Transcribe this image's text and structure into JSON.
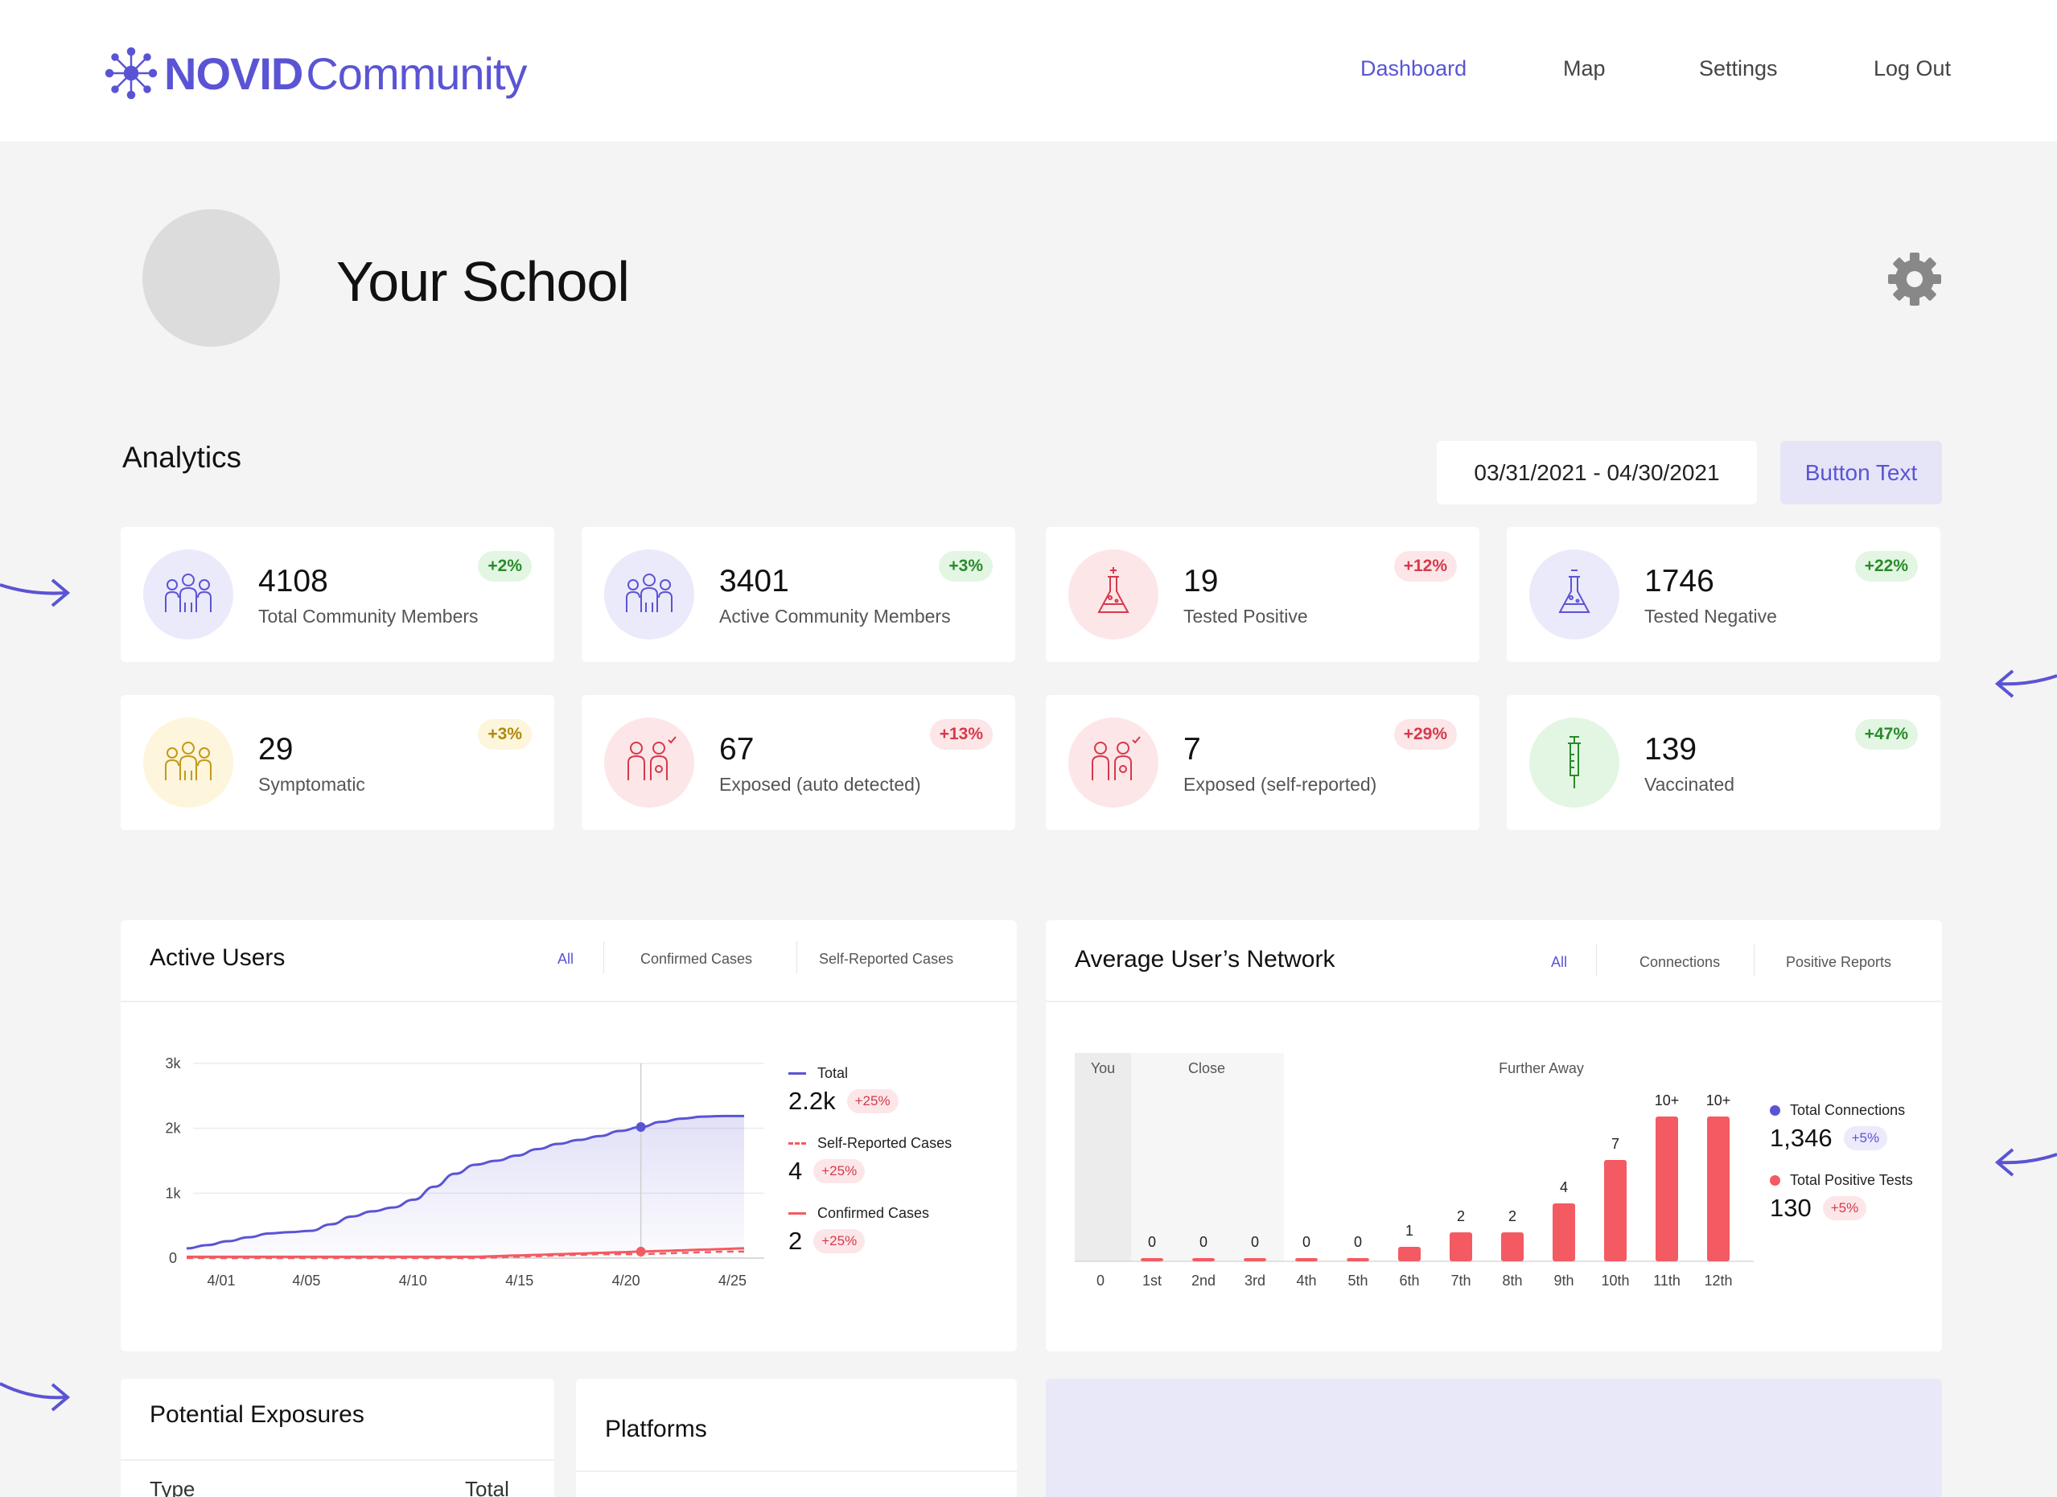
{
  "brand": {
    "bold": "NOVID",
    "light": "Community"
  },
  "nav": [
    {
      "label": "Dashboard",
      "active": true
    },
    {
      "label": "Map",
      "active": false
    },
    {
      "label": "Settings",
      "active": false
    },
    {
      "label": "Log Out",
      "active": false
    }
  ],
  "school": {
    "name": "Your School"
  },
  "analytics": {
    "title": "Analytics",
    "date_range": "03/31/2021 - 04/30/2021",
    "button_label": "Button Text"
  },
  "stats": [
    {
      "value": "4108",
      "label": "Total Community Members",
      "change": "+2%",
      "tone": "green",
      "icon": "people-icon"
    },
    {
      "value": "3401",
      "label": "Active Community Members",
      "change": "+3%",
      "tone": "green",
      "icon": "people-icon"
    },
    {
      "value": "19",
      "label": "Tested Positive",
      "change": "+12%",
      "tone": "red",
      "icon": "flask-positive-icon"
    },
    {
      "value": "1746",
      "label": "Tested Negative",
      "change": "+22%",
      "tone": "green",
      "icon": "flask-negative-icon"
    },
    {
      "value": "29",
      "label": "Symptomatic",
      "change": "+3%",
      "tone": "yellow",
      "icon": "symptomatic-people-icon"
    },
    {
      "value": "67",
      "label": "Exposed (auto detected)",
      "change": "+13%",
      "tone": "red",
      "icon": "exposed-people-icon"
    },
    {
      "value": "7",
      "label": "Exposed (self-reported)",
      "change": "+29%",
      "tone": "red",
      "icon": "exposed-people-icon"
    },
    {
      "value": "139",
      "label": "Vaccinated",
      "change": "+47%",
      "tone": "green",
      "icon": "syringe-icon"
    }
  ],
  "colors": {
    "accent": "#5a54d4",
    "positive_red": "#f45a62",
    "green": "#2a8a2a"
  },
  "active_users": {
    "title": "Active Users",
    "tabs": [
      {
        "label": "All",
        "active": true
      },
      {
        "label": "Confirmed Cases",
        "active": false
      },
      {
        "label": "Self-Reported Cases",
        "active": false
      }
    ],
    "legend": [
      {
        "name": "Total",
        "value": "2.2k",
        "change": "+25%"
      },
      {
        "name": "Self-Reported Cases",
        "value": "4",
        "change": "+25%"
      },
      {
        "name": "Confirmed Cases",
        "value": "2",
        "change": "+25%"
      }
    ]
  },
  "network": {
    "title": "Average User’s Network",
    "tabs": [
      {
        "label": "All",
        "active": true
      },
      {
        "label": "Connections",
        "active": false
      },
      {
        "label": "Positive Reports",
        "active": false
      }
    ],
    "region_labels": {
      "you": "You",
      "close": "Close",
      "further": "Further Away"
    },
    "legend": [
      {
        "name": "Total Connections",
        "value": "1,346",
        "change": "+5%"
      },
      {
        "name": "Total Positive Tests",
        "value": "130",
        "change": "+5%"
      }
    ]
  },
  "lower": {
    "exposures_title": "Potential Exposures",
    "exposures_headers": [
      "Type",
      "Total"
    ],
    "platforms_title": "Platforms"
  },
  "chart_data": [
    {
      "type": "area",
      "ylim": [
        0,
        3000
      ],
      "ytick_labels": [
        "0",
        "1k",
        "2k",
        "3k"
      ],
      "xtick_labels": [
        "4/01",
        "4/05",
        "4/10",
        "4/15",
        "4/20",
        "4/25"
      ],
      "x": [
        1,
        2,
        3,
        4,
        5,
        6,
        7,
        8,
        9,
        10,
        11,
        12,
        13,
        14,
        15,
        16,
        17,
        18,
        19,
        20,
        21,
        22,
        23,
        24,
        25,
        26,
        27,
        28
      ],
      "series": [
        {
          "name": "Total",
          "values": [
            150,
            200,
            260,
            320,
            380,
            400,
            420,
            520,
            640,
            720,
            780,
            900,
            1100,
            1300,
            1440,
            1500,
            1580,
            1680,
            1760,
            1820,
            1880,
            1960,
            2020,
            2100,
            2150,
            2180,
            2190,
            2190
          ]
        },
        {
          "name": "Self-Reported Cases",
          "values": [
            0,
            0,
            0,
            0,
            0,
            0,
            0,
            0,
            0,
            0,
            0,
            0,
            0,
            0,
            0,
            10,
            20,
            30,
            40,
            50,
            60,
            60,
            60,
            70,
            80,
            90,
            100,
            100
          ]
        },
        {
          "name": "Confirmed Cases",
          "values": [
            20,
            20,
            20,
            20,
            20,
            20,
            20,
            20,
            20,
            20,
            20,
            20,
            20,
            20,
            20,
            30,
            40,
            50,
            60,
            70,
            80,
            90,
            100,
            110,
            120,
            130,
            140,
            150
          ]
        }
      ]
    },
    {
      "type": "bar",
      "categories": [
        "0",
        "1st",
        "2nd",
        "3rd",
        "4th",
        "5th",
        "6th",
        "7th",
        "8th",
        "9th",
        "10th",
        "11th",
        "12th"
      ],
      "values": [
        null,
        0,
        0,
        0,
        0,
        0,
        1,
        2,
        2,
        4,
        7,
        10,
        10
      ],
      "value_labels": [
        "",
        "0",
        "0",
        "0",
        "0",
        "0",
        "1",
        "2",
        "2",
        "4",
        "7",
        "10+",
        "10+"
      ]
    }
  ]
}
